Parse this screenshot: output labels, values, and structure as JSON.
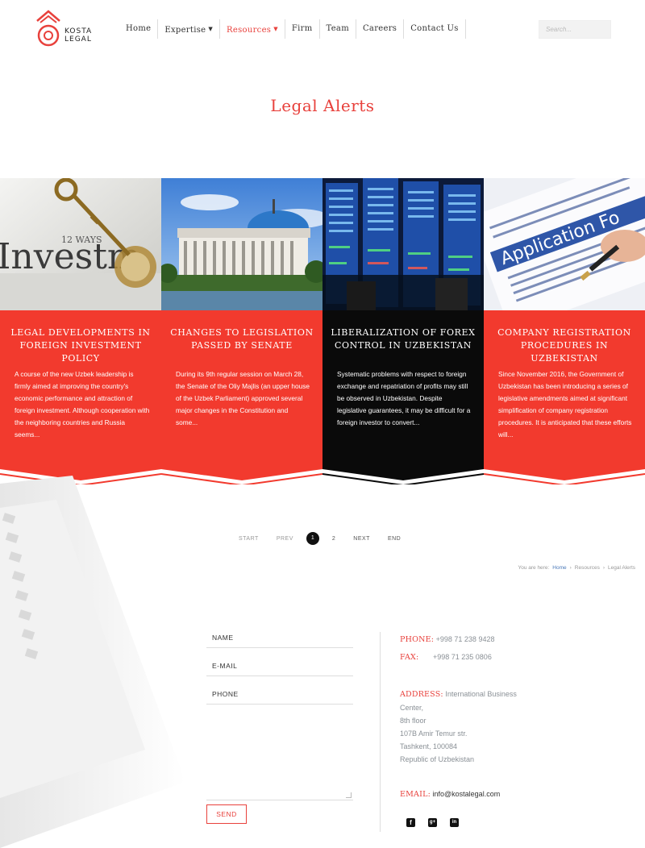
{
  "header": {
    "logo_line1": "KOSTA",
    "logo_line2": "LEGAL",
    "nav": [
      {
        "label": "Home"
      },
      {
        "label": "Expertise"
      },
      {
        "label": "Resources"
      },
      {
        "label": "Firm"
      },
      {
        "label": "Team"
      },
      {
        "label": "Careers"
      },
      {
        "label": "Contact Us"
      }
    ],
    "search_placeholder": "Search..."
  },
  "page_title": "Legal Alerts",
  "cards": [
    {
      "title": "Legal developments in foreign investment policy",
      "text": "A course of the new Uzbek leadership is firmly aimed at improving the country's economic performance and attraction of foreign investment. Although cooperation with the neighboring countries and Russia seems...",
      "theme": "red",
      "image": "investment-key-image"
    },
    {
      "title": "Changes to legislation passed by Senate",
      "text": "During its 9th regular session on March 28, the Senate of the Oliy Majlis (an upper house of the Uzbek Parliament) approved several major changes in the Constitution and some...",
      "theme": "red",
      "image": "parliament-building-image"
    },
    {
      "title": "Liberalization of forex control in Uzbekistan",
      "text": "Systematic problems with respect to foreign exchange and repatriation of profits may still be observed in Uzbekistan. Despite legislative guarantees, it may be difficult for a foreign investor to convert...",
      "theme": "black",
      "image": "forex-board-image"
    },
    {
      "title": "Company registration procedures in Uzbekistan",
      "text": "Since November 2016, the Government of Uzbekistan has been introducing a series of legislative amendments aimed at significant simplification of company registration procedures. It is anticipated that these efforts will...",
      "theme": "red",
      "image": "application-form-image"
    }
  ],
  "pagination": {
    "start": "Start",
    "prev": "Prev",
    "current": "1",
    "page2": "2",
    "next": "Next",
    "end": "End"
  },
  "breadcrumb": {
    "prefix": "You are here:",
    "home": "Home",
    "resources": "Resources",
    "current": "Legal Alerts",
    "sep": "›"
  },
  "form": {
    "name": "Name",
    "email": "E-mail",
    "phone": "Phone",
    "send": "Send"
  },
  "contact": {
    "phone_label": "Phone:",
    "phone": "+998 71 238 9428",
    "fax_label": "Fax:",
    "fax": "+998 71 235 0806",
    "address_label": "Address:",
    "address_line1": "International Business Center,",
    "address_line2": "8th floor",
    "address_line3": "107B Amir Temur str.",
    "address_line4": "Tashkent, 100084",
    "address_line5": "Republic of Uzbekistan",
    "email_label": "Email:",
    "email": "info@kostalegal.com"
  },
  "socials": [
    {
      "icon": "facebook-icon",
      "glyph": "f"
    },
    {
      "icon": "google-plus-icon",
      "glyph": "g+"
    },
    {
      "icon": "linkedin-icon",
      "glyph": "in"
    }
  ],
  "colors": {
    "accent": "#e8413c",
    "dark_card": "#0a0a0a"
  }
}
